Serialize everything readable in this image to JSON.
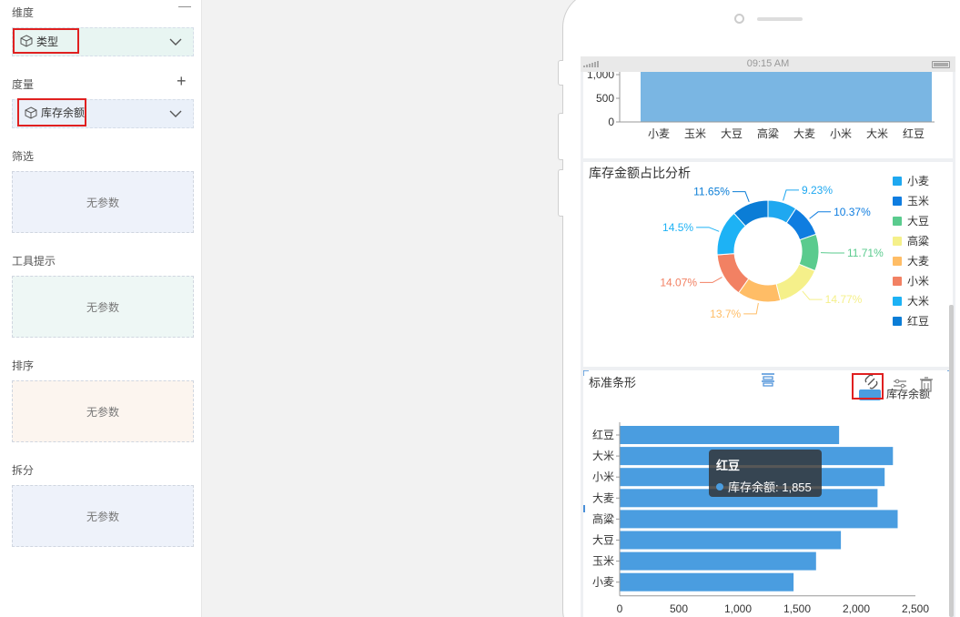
{
  "panel": {
    "dimension_label": "维度",
    "dimension_chip": "类型",
    "measure_label": "度量",
    "measure_chip": "库存余额",
    "filter_label": "筛选",
    "filter_empty": "无参数",
    "tooltip_label": "工具提示",
    "tooltip_empty": "无参数",
    "sort_label": "排序",
    "sort_empty": "无参数",
    "split_label": "拆分",
    "split_empty": "无参数"
  },
  "statusbar": {
    "time": "09:15 AM"
  },
  "colors": {
    "bar_top": "#7ab6e3",
    "bar_h": "#4a9de0",
    "donut": [
      "#1fa8f0",
      "#0f7de0",
      "#5acb8e",
      "#f5f08a",
      "#ffbd66",
      "#f28163",
      "#1db2f5",
      "#0b7dd6"
    ]
  },
  "top_chart": {
    "yticks": [
      "1,000",
      "500",
      "0"
    ],
    "categories": [
      "小麦",
      "玉米",
      "大豆",
      "高粱",
      "大麦",
      "小米",
      "大米",
      "红豆"
    ]
  },
  "donut_card": {
    "title": "库存金额占比分析",
    "legend": [
      "小麦",
      "玉米",
      "大豆",
      "高粱",
      "大麦",
      "小米",
      "大米",
      "红豆"
    ],
    "labels": [
      "9.23%",
      "10.37%",
      "11.71%",
      "14.77%",
      "13.7%",
      "14.07%",
      "14.5%",
      "11.65%"
    ]
  },
  "bar_card": {
    "title": "标准条形",
    "legend_label": "库存余额",
    "xticks": [
      "0",
      "500",
      "1,000",
      "1,500",
      "2,000",
      "2,500"
    ]
  },
  "tooltip": {
    "category": "红豆",
    "text": "库存余额: 1,855"
  },
  "chart_data": [
    {
      "type": "pie",
      "title": "库存金额占比分析",
      "categories": [
        "小麦",
        "玉米",
        "大豆",
        "高粱",
        "大麦",
        "小米",
        "大米",
        "红豆"
      ],
      "values": [
        9.23,
        10.37,
        11.71,
        14.77,
        13.7,
        14.07,
        14.5,
        11.65
      ],
      "legend_position": "right"
    },
    {
      "type": "bar",
      "title": "标准条形",
      "orientation": "horizontal",
      "categories": [
        "红豆",
        "大米",
        "小米",
        "大麦",
        "高粱",
        "大豆",
        "玉米",
        "小麦"
      ],
      "series": [
        {
          "name": "库存余额",
          "values": [
            1855,
            2310,
            2240,
            2180,
            2350,
            1870,
            1660,
            1470
          ]
        }
      ],
      "xlim": [
        0,
        2500
      ]
    }
  ]
}
